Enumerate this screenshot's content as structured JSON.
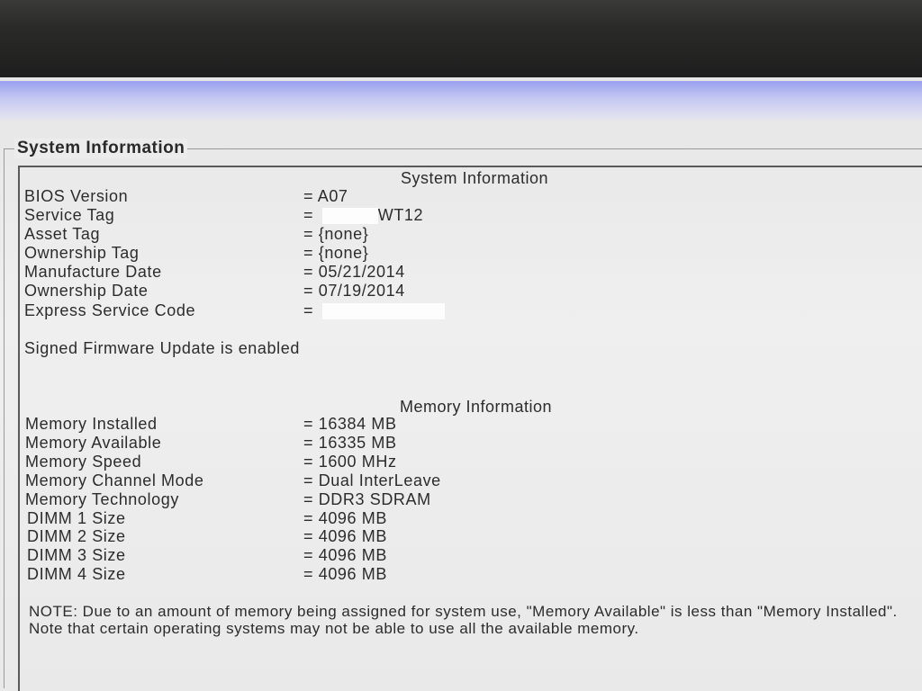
{
  "group_title": "System Information",
  "system": {
    "heading": "System Information",
    "rows": [
      {
        "label": "BIOS Version",
        "value": "= A07"
      },
      {
        "label": "Service Tag",
        "value_prefix": "=",
        "value_suffix": "WT12"
      },
      {
        "label": "Asset Tag",
        "value": "= {none}"
      },
      {
        "label": "Ownership Tag",
        "value": "= {none}"
      },
      {
        "label": "Manufacture Date",
        "value": "= 05/21/2014"
      },
      {
        "label": "Ownership Date",
        "value": "= 07/19/2014"
      },
      {
        "label": "Express Service Code",
        "value_prefix": "="
      }
    ],
    "firmware_status": "Signed Firmware Update is enabled"
  },
  "memory": {
    "heading": "Memory Information",
    "rows": [
      {
        "label": "Memory Installed",
        "value": "= 16384 MB"
      },
      {
        "label": "Memory Available",
        "value": "= 16335 MB"
      },
      {
        "label": "Memory Speed",
        "value": "= 1600 MHz"
      },
      {
        "label": "Memory Channel Mode",
        "value": "= Dual InterLeave"
      },
      {
        "label": "Memory Technology",
        "value": "= DDR3 SDRAM"
      },
      {
        "label": "DIMM 1 Size",
        "value": "= 4096 MB"
      },
      {
        "label": "DIMM 2 Size",
        "value": "= 4096 MB"
      },
      {
        "label": "DIMM 3 Size",
        "value": "= 4096 MB"
      },
      {
        "label": "DIMM 4 Size",
        "value": "= 4096 MB"
      }
    ],
    "note": "NOTE: Due to an amount of memory being assigned for system use, \"Memory Available\" is less than \"Memory Installed\". Note that certain operating systems may not be able to use all the available memory."
  }
}
